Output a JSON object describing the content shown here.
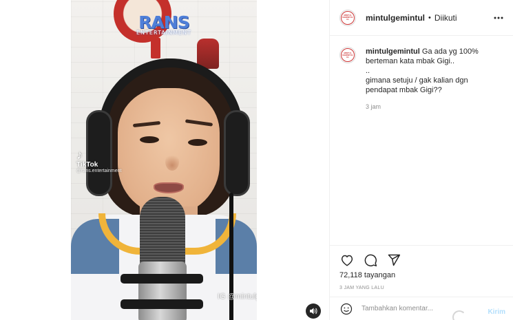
{
  "post": {
    "username": "mintulgemintul",
    "follow_status": "Diikuti",
    "header_separator": "•",
    "avatar_text": [
      "MINTUL",
      "GEMINTUL",
      "IG"
    ]
  },
  "media": {
    "logo_text": "RANS",
    "logo_subtext": "ENTERTAINMENT",
    "tiktok_label": "TikTok",
    "tiktok_handle": "@rans.entertainment",
    "watermark": "IG @mintulgemintul"
  },
  "caption": {
    "username": "mintulgemintul",
    "lines": [
      "Ga ada yg 100%",
      "berteman kata mbak Gigi..",
      "..",
      "gimana setuju / gak kalian dgn",
      "pendapat mbak Gigi??"
    ],
    "time": "3 jam"
  },
  "stats": {
    "views": "72,118 tayangan",
    "posted": "3 JAM YANG LALU"
  },
  "comment": {
    "placeholder": "Tambahkan komentar...",
    "send_label": "Kirim"
  },
  "icons": {
    "like": "heart-icon",
    "comment": "comment-icon",
    "share": "share-icon",
    "more": "more-icon",
    "sound": "speaker-icon",
    "emoji": "emoji-icon"
  }
}
